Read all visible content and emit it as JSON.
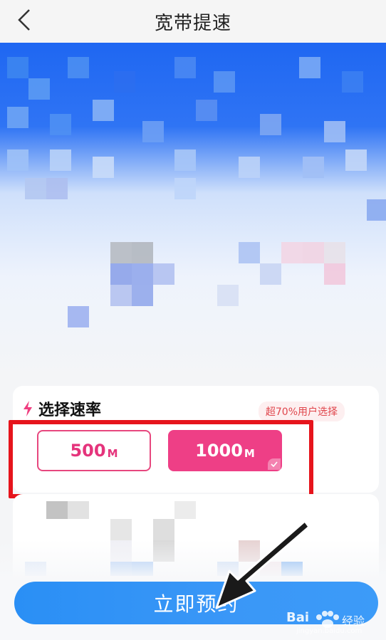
{
  "header": {
    "title": "宽带提速",
    "back_icon": "chevron-left-icon"
  },
  "speed_section": {
    "title": "选择速率",
    "badge": "超70%用户选择",
    "options": [
      {
        "value": "500",
        "unit": "M",
        "selected": false
      },
      {
        "value": "1000",
        "unit": "M",
        "selected": true
      }
    ]
  },
  "actions": {
    "book_label": "立即预约"
  },
  "colors": {
    "accent_pink": "#ee3f86",
    "button_blue": "#2a8ff5",
    "highlight_red": "#e6141c"
  },
  "watermark": {
    "brand": "Bai",
    "brand_suffix": "经验",
    "url": "jingyan.baidu.com"
  }
}
